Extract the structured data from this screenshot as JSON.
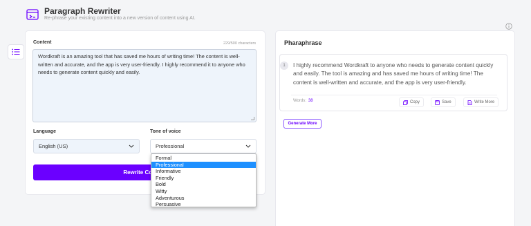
{
  "header": {
    "title": "Paragraph Rewriter",
    "subtitle": "Re-phrase your existing content into a new version of content using AI."
  },
  "content": {
    "label": "Content",
    "char_count": "229/500 characters",
    "text": "Wordkraft is an amazing tool that has saved me hours of writing time! The content is well-written and accurate, and the app is very user-friendly. I highly recommend it to anyone who needs to generate content quickly and easily."
  },
  "language": {
    "label": "Language",
    "value": "English (US)"
  },
  "tone": {
    "label": "Tone of voice",
    "value": "Professional",
    "options": [
      "Formal",
      "Professional",
      "Informative",
      "Friendly",
      "Bold",
      "Witty",
      "Adventurous",
      "Persuasive"
    ],
    "selected_index": 1
  },
  "rewrite_button": {
    "label": "Rewrite Content"
  },
  "paraphrase": {
    "title": "Pharaphrase",
    "item_number": "1",
    "text": "I highly recommend Wordkraft to anyone who needs to generate content quickly and easily. The tool is amazing and has saved me hours of writing time! The content is well-written and accurate, and the app is very user-friendly.",
    "words_label": "Words:",
    "words_count": "38",
    "copy_label": "Copy",
    "save_label": "Save",
    "write_more_label": "Write More",
    "generate_more_label": "Generate More"
  },
  "colors": {
    "accent": "#6b00ff",
    "selected_option": "#1e90ff"
  },
  "icons": [
    "rewriter-icon",
    "info-icon",
    "menu-list-icon",
    "chevron-down-icon",
    "copy-icon",
    "save-icon",
    "write-more-icon"
  ]
}
